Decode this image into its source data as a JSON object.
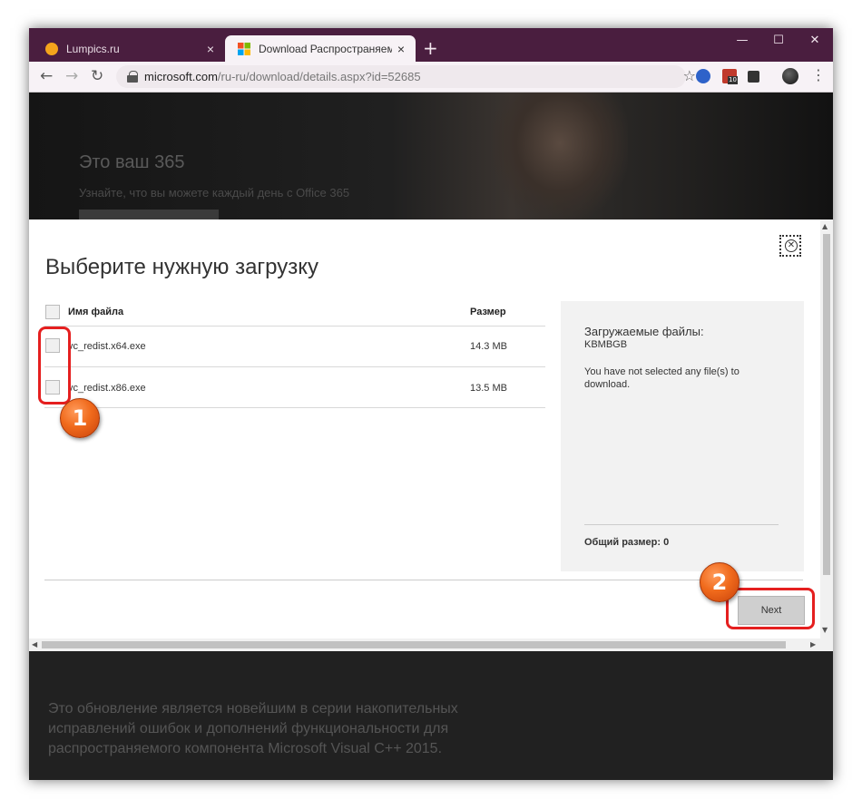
{
  "browser": {
    "tabs": [
      {
        "title": "Lumpics.ru",
        "active": false,
        "close": "×"
      },
      {
        "title": "Download Распространяемый к",
        "active": true,
        "close": "×"
      }
    ],
    "new_tab": "+",
    "window_controls": {
      "minimize": "—",
      "maximize": "☐",
      "close": "✕"
    },
    "nav": {
      "back": "←",
      "forward": "→",
      "reload": "↻"
    },
    "address": {
      "host": "microsoft.com",
      "path": "/ru-ru/download/details.aspx?id=52685"
    },
    "bookmark": "☆",
    "extension_badge": "10"
  },
  "hero": {
    "title": "Это ваш 365",
    "subtitle": "Узнайте, что вы можете каждый день с Office 365"
  },
  "modal": {
    "title": "Выберите нужную загрузку",
    "close": "✕",
    "table": {
      "headers": {
        "filename": "Имя файла",
        "size": "Размер"
      },
      "rows": [
        {
          "filename": "vc_redist.x64.exe",
          "size": "14.3 MB"
        },
        {
          "filename": "vc_redist.x86.exe",
          "size": "13.5 MB"
        }
      ]
    },
    "summary": {
      "title": "Загружаемые файлы:",
      "size_label": "KBMBGB",
      "message": "You have not selected any file(s) to download.",
      "total": "Общий размер: 0"
    },
    "next_button": "Next"
  },
  "annotations": {
    "badge1": "1",
    "badge2": "2",
    "highlight_color": "#e51f1f"
  },
  "page": {
    "description": "Это обновление является новейшим в серии накопительных исправлений ошибок и дополнений функциональности для распространяемого компонента Microsoft Visual C++ 2015."
  },
  "colors": {
    "titlebar": "#4a1e3f",
    "toolbar": "#f7f2f6",
    "summary_bg": "#f2f2f2",
    "button": "#cfcfcf"
  }
}
